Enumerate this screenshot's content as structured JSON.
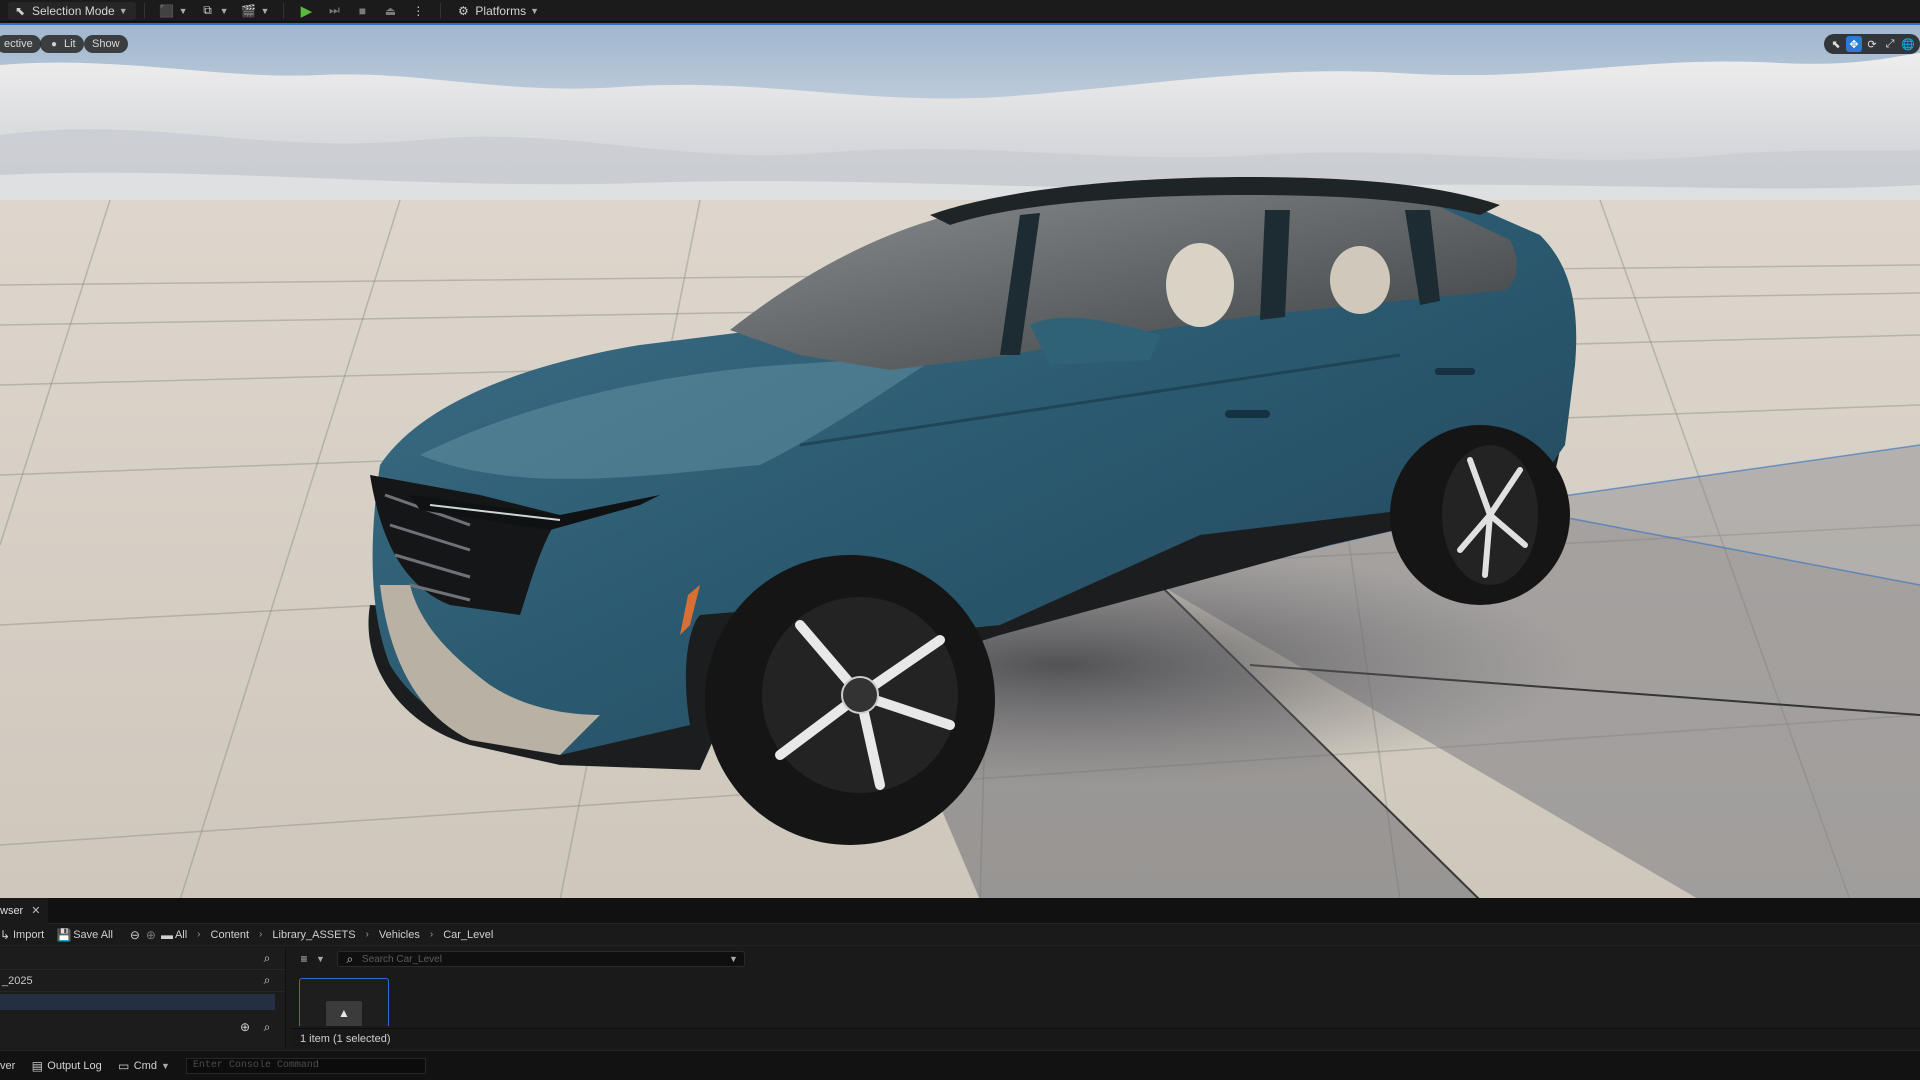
{
  "toolbar": {
    "selection_mode": "Selection Mode",
    "platforms": "Platforms"
  },
  "viewport": {
    "perspective": "ective",
    "lit": "Lit",
    "show": "Show"
  },
  "content_browser": {
    "tab_label": "wser",
    "import": "Import",
    "save_all": "Save All",
    "breadcrumb": [
      "All",
      "Content",
      "Library_ASSETS",
      "Vehicles",
      "Car_Level"
    ],
    "folder_item": "_2025",
    "search_placeholder": "Search Car_Level",
    "item_count": "1 item (1 selected)"
  },
  "status_bar": {
    "drawer": "ver",
    "output_log": "Output Log",
    "cmd": "Cmd",
    "console_placeholder": "Enter Console Command"
  },
  "colors": {
    "accent": "#2c7ad6",
    "play": "#5ab83f",
    "car_body": "#2c5a6e"
  }
}
